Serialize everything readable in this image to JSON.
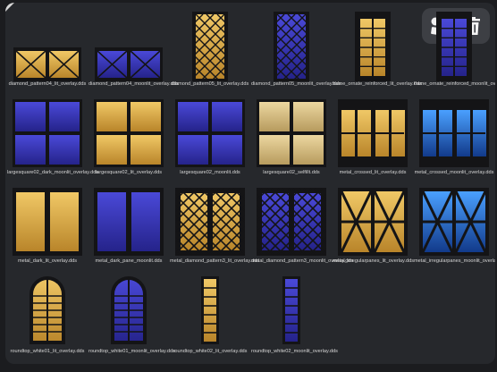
{
  "toolbar": {
    "tools": [
      {
        "name": "shapes-icon",
        "label": ""
      },
      {
        "name": "trash-icon",
        "label": ""
      }
    ]
  },
  "colors": {
    "lit": "#e8b44a",
    "moon": "#3e3dc8",
    "frame": "#141416",
    "blue_glow": "#3b7ad6"
  },
  "files": [
    {
      "label": "diamond_pattern04_lit_overlay.dds",
      "kind": "diamond",
      "tone": "lit"
    },
    {
      "label": "diamond_pattern04_moonlit_overlay.dds",
      "kind": "diamond",
      "tone": "moon"
    },
    {
      "label": "diamond_pattern05_lit_overlay.dds",
      "kind": "diamond-tall",
      "tone": "lit"
    },
    {
      "label": "diamond_pattern05_moonlit_overlay.dds",
      "kind": "diamond-tall",
      "tone": "moon"
    },
    {
      "label": "frame_ornate_reinforced_lit_overlay.dds",
      "kind": "frame-tall",
      "tone": "lit"
    },
    {
      "label": "frame_ornate_reinforced_moonlit_overlay.dds",
      "kind": "frame-tall",
      "tone": "moon"
    },
    {
      "label": "largesquare02_dark_moonlit_overlay.dds",
      "kind": "square",
      "tone": "moon"
    },
    {
      "label": "largesquare02_lit_overlay.dds",
      "kind": "square",
      "tone": "lit"
    },
    {
      "label": "largesquare02_moonlit.dds",
      "kind": "square",
      "tone": "moon"
    },
    {
      "label": "largesquare02_selfillt.dds",
      "kind": "square",
      "tone": "pale"
    },
    {
      "label": "metal_crossed_lit_overlay.dds",
      "kind": "crossed",
      "tone": "lit"
    },
    {
      "label": "metal_crossed_moonlit_overlay.dds",
      "kind": "crossed",
      "tone": "glow"
    },
    {
      "label": "metal_dark_lit_overlay.dds",
      "kind": "dark",
      "tone": "lit"
    },
    {
      "label": "metal_dark_pane_moonlit.dds",
      "kind": "dark",
      "tone": "moon"
    },
    {
      "label": "metal_diamond_pattern3_lit_overlay.dds",
      "kind": "mdiamond",
      "tone": "lit"
    },
    {
      "label": "metal_diamond_pattern3_moonlit_overlay.dds",
      "kind": "mdiamond",
      "tone": "moon"
    },
    {
      "label": "metal_irregularpanes_lit_overlay.dds",
      "kind": "irregular",
      "tone": "lit"
    },
    {
      "label": "metal_irregularpanes_moonlit_overlay.dds",
      "kind": "irregular",
      "tone": "glow"
    },
    {
      "label": "roundtop_white01_lit_overlay.dds",
      "kind": "roundtop",
      "tone": "lit"
    },
    {
      "label": "roundtop_white01_moonlit_overlay.dds",
      "kind": "roundtop",
      "tone": "moon"
    },
    {
      "label": "roundtop_white02_lit_overlay.dds",
      "kind": "slim",
      "tone": "lit"
    },
    {
      "label": "roundtop_white02_moonlit_overlay.dds",
      "kind": "slim",
      "tone": "moon"
    }
  ]
}
